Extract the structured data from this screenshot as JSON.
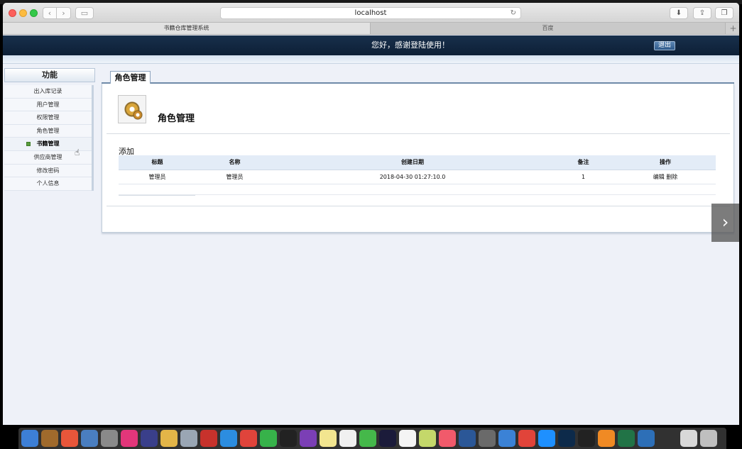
{
  "browser": {
    "url": "localhost",
    "tabs": [
      {
        "label": "书籍仓库管理系统"
      },
      {
        "label": "百度"
      }
    ]
  },
  "banner": {
    "greeting": "您好，感谢登陆使用！",
    "logout_label": "退出"
  },
  "sidebar": {
    "title": "功能",
    "items": [
      {
        "label": "出入库记录"
      },
      {
        "label": "用户管理"
      },
      {
        "label": "权限管理"
      },
      {
        "label": "角色管理"
      },
      {
        "label": "书籍管理"
      },
      {
        "label": "供应商管理"
      },
      {
        "label": "修改密码"
      },
      {
        "label": "个人信息"
      }
    ],
    "active_index": 4
  },
  "main": {
    "tab_label": "角色管理",
    "heading": "角色管理",
    "add_label": "添加",
    "table": {
      "columns": [
        "标题",
        "名称",
        "创建日期",
        "备注",
        "操作"
      ],
      "rows": [
        {
          "title": "管理员",
          "name": "管理员",
          "created": "2018-04-30 01:27:10.0",
          "note": "1",
          "edit": "编辑",
          "delete": "删除"
        }
      ]
    }
  },
  "colors": {
    "banner": "#0d1f36",
    "table_header": "#e3ecf7",
    "page_bg": "#eef1f8"
  }
}
